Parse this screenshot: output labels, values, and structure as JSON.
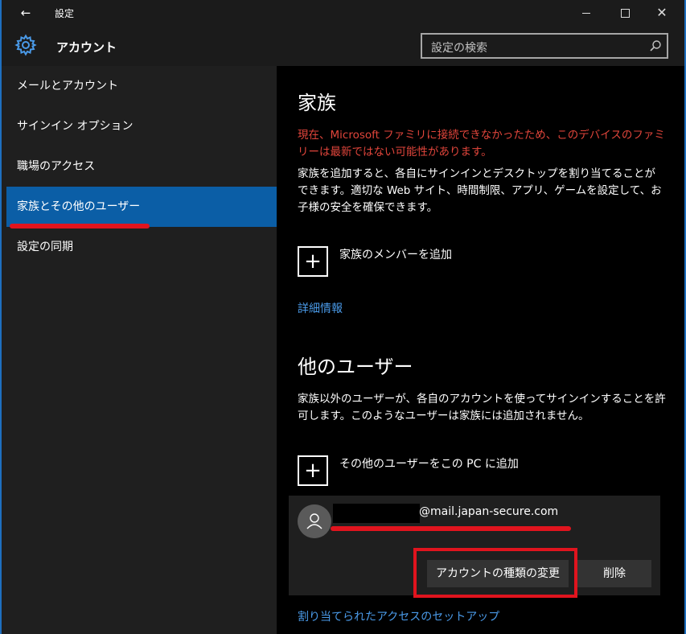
{
  "window": {
    "title": "設定",
    "back_glyph": "←",
    "close_glyph": "✕"
  },
  "header": {
    "heading": "アカウント",
    "search_placeholder": "設定の検索"
  },
  "sidebar": {
    "items": [
      {
        "label": "メールとアカウント",
        "active": false
      },
      {
        "label": "サインイン オプション",
        "active": false
      },
      {
        "label": "職場のアクセス",
        "active": false
      },
      {
        "label": "家族とその他のユーザー",
        "active": true
      },
      {
        "label": "設定の同期",
        "active": false
      }
    ]
  },
  "family": {
    "heading": "家族",
    "error": "現在、Microsoft ファミリに接続できなかったため、このデバイスのファミリーは最新ではない可能性があります。",
    "description": "家族を追加すると、各自にサインインとデスクトップを割り当てることができます。適切な Web サイト、時間制限、アプリ、ゲームを設定して、お子様の安全を確保できます。",
    "add_label": "家族のメンバーを追加",
    "more_info": "詳細情報"
  },
  "others": {
    "heading": "他のユーザー",
    "description": "家族以外のユーザーが、各自のアカウントを使ってサインインすることを許可します。このようなユーザーは家族には追加されません。",
    "add_label": "その他のユーザーをこの PC に追加",
    "user_email_suffix": "@mail.japan-secure.com",
    "change_type_button": "アカウントの種類の変更",
    "delete_button": "削除",
    "assigned_access_link": "割り当てられたアクセスのセットアップ"
  },
  "colors": {
    "accent": "#0b5ea6",
    "error_text": "#e0453b",
    "link": "#4a9ae8",
    "annotation_red": "#e0141e"
  }
}
